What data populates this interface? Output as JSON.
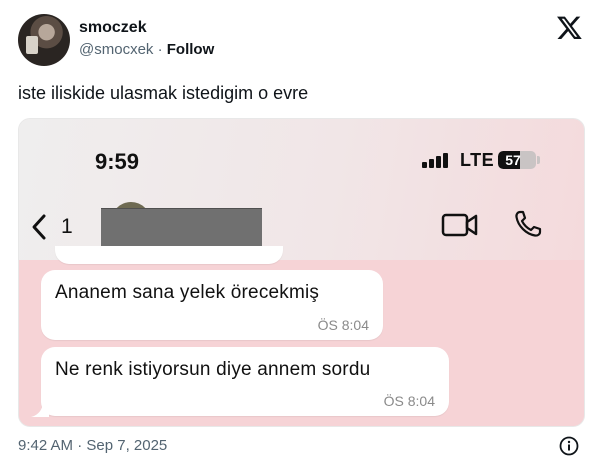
{
  "author": {
    "name": "smoczek",
    "handle": "@smocxek",
    "separator": "·",
    "follow_label": "Follow"
  },
  "tweet": {
    "text": "iste iliskide ulasmak istedigim o evre",
    "timestamp": "9:42 AM · Sep 7, 2025"
  },
  "icons": {
    "brand": "x-logo-icon",
    "info": "info-icon",
    "back": "chevron-left-icon",
    "video": "video-camera-icon",
    "call": "phone-icon"
  },
  "screenshot": {
    "status_bar": {
      "time": "9:59",
      "network": "LTE",
      "battery": "57",
      "battery_level": 0.57
    },
    "chat_header": {
      "back_count": "1"
    },
    "messages": [
      {
        "text": "Ananem sana yelek örecekmiş",
        "time": "ÖS 8:04"
      },
      {
        "text": "Ne renk istiyorsun diye annem sordu",
        "time": "ÖS 8:04"
      }
    ]
  },
  "colors": {
    "text": "#0f1419",
    "secondary": "#536471",
    "chat_background": "#f6d3d6",
    "bubble": "#ffffff",
    "redaction": "#707070"
  }
}
